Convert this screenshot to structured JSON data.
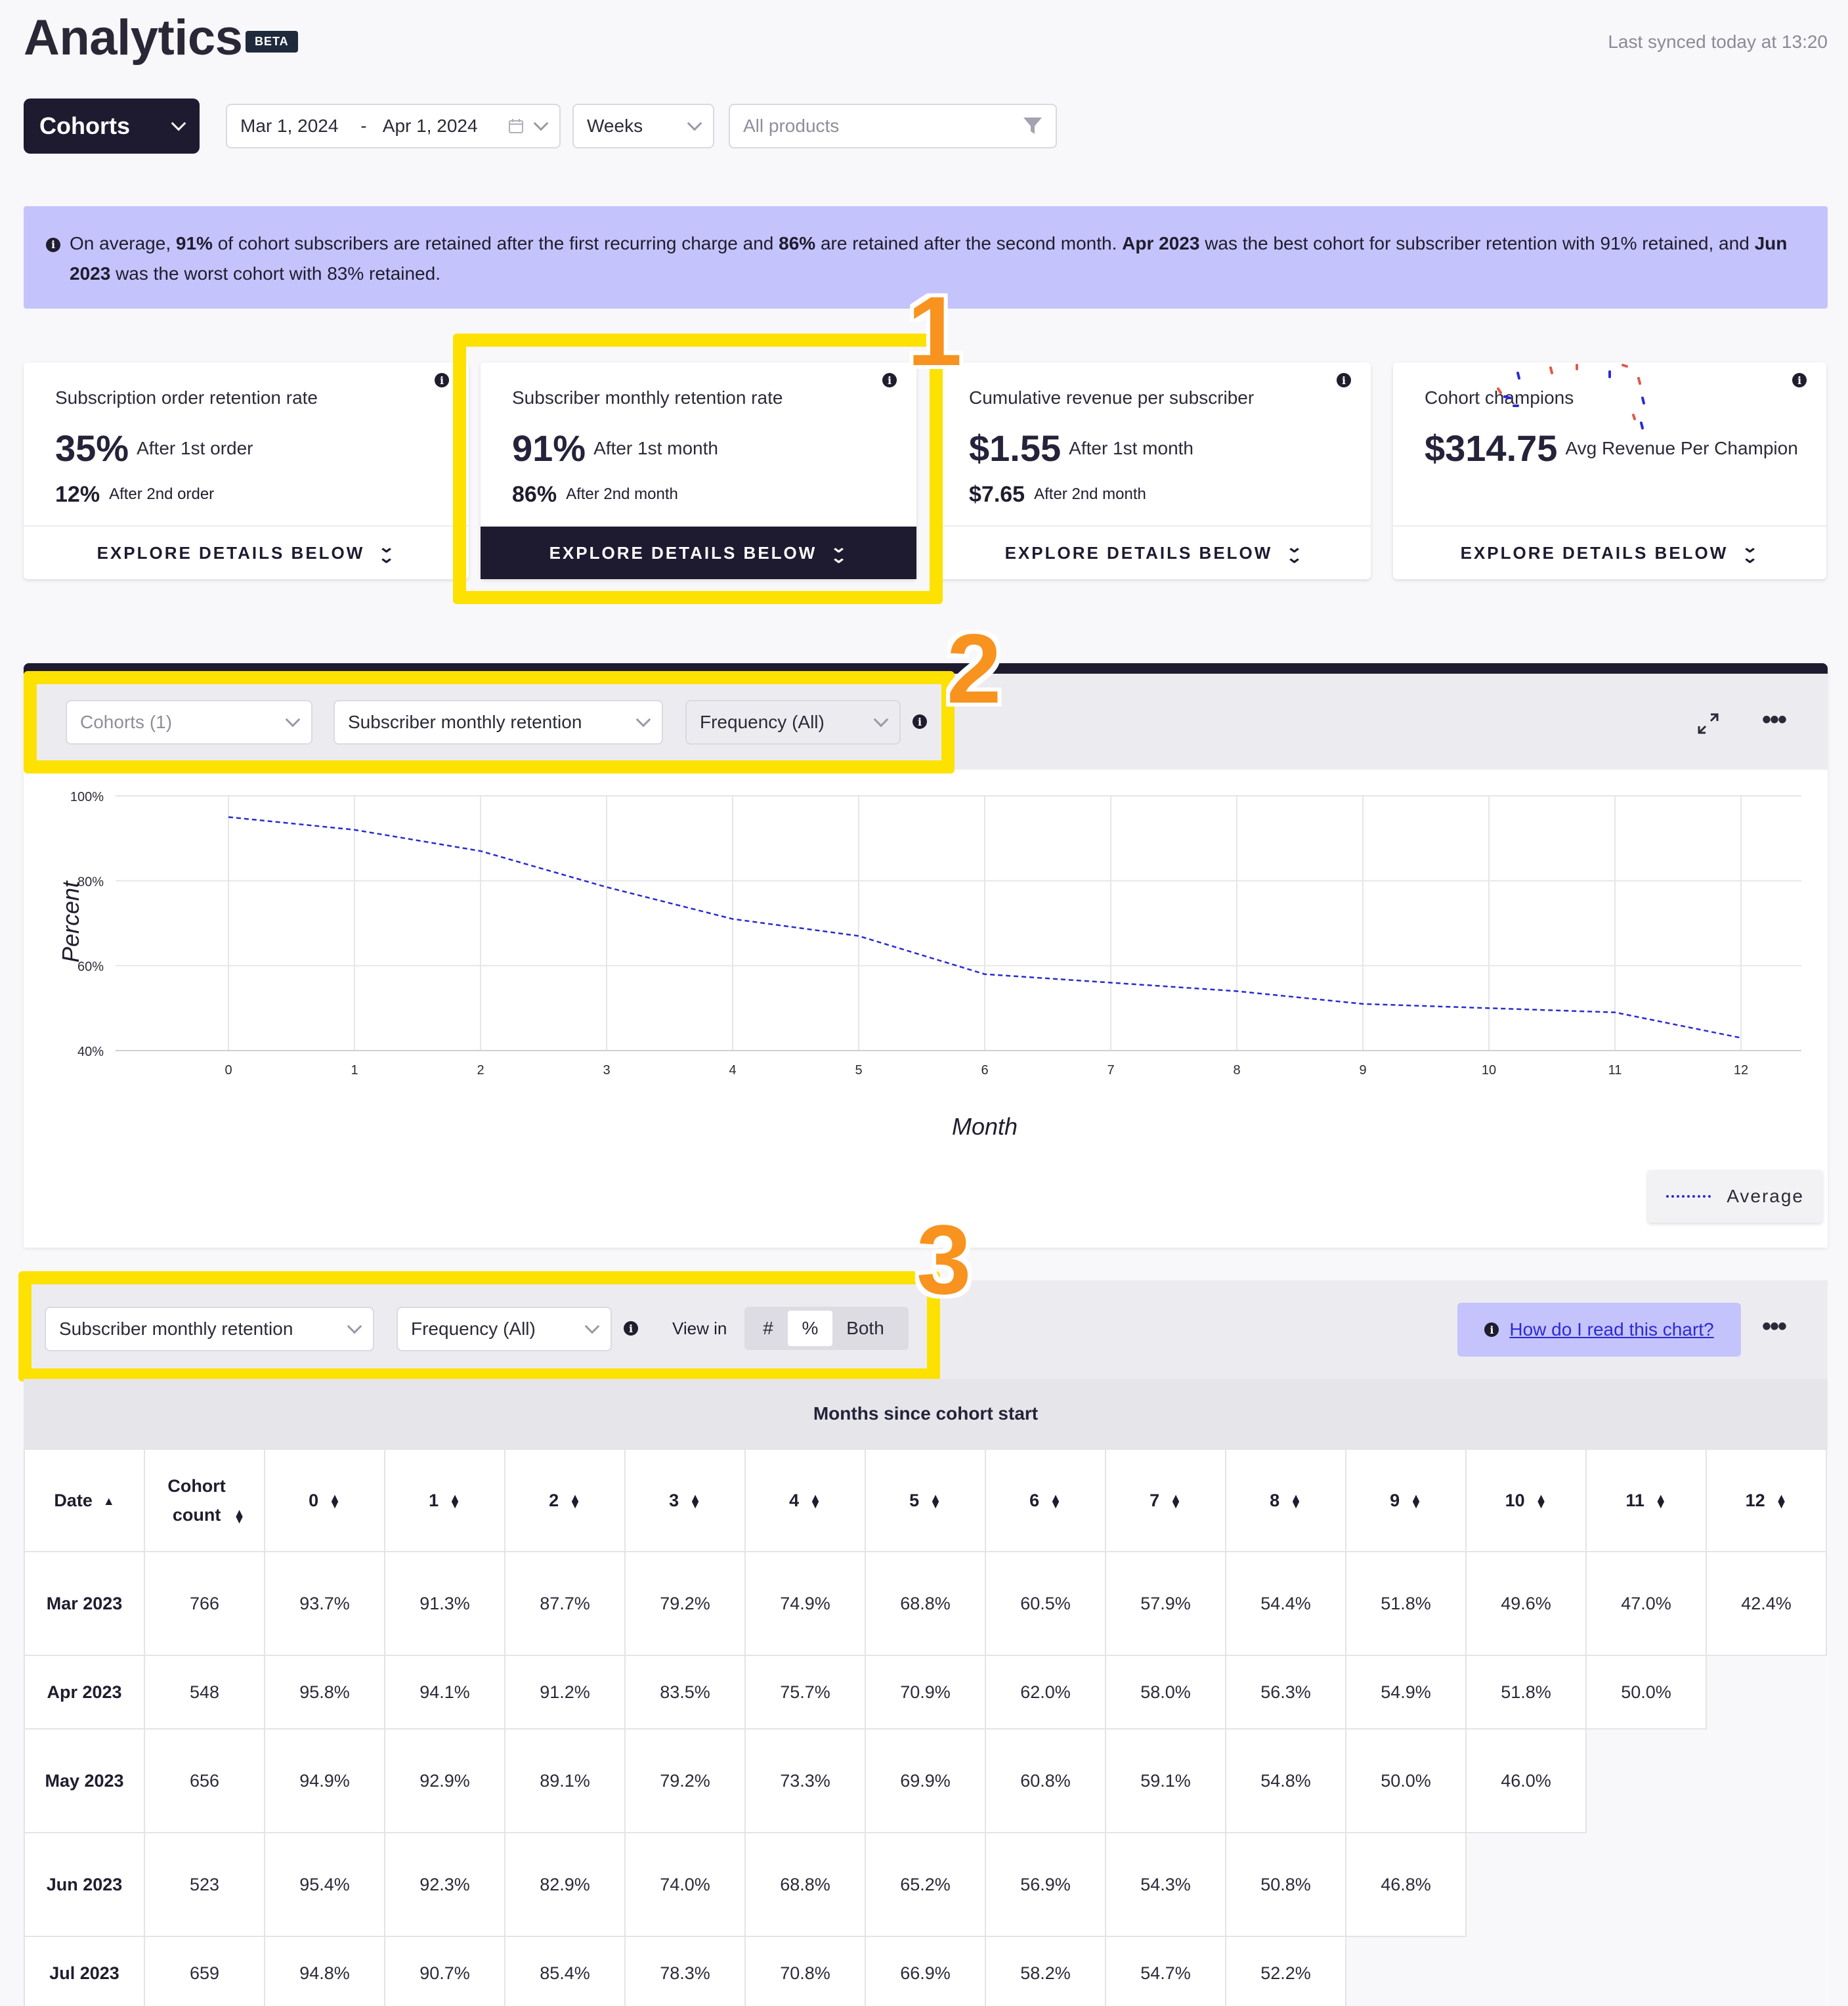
{
  "header": {
    "title": "Analytics",
    "beta": "BETA",
    "synced": "Last synced today at 13:20"
  },
  "toolbar": {
    "view": "Cohorts",
    "date_start": "Mar 1, 2024",
    "date_sep": "-",
    "date_end": "Apr 1, 2024",
    "interval": "Weeks",
    "products_placeholder": "All products"
  },
  "banner": {
    "t1": "On average, ",
    "b1": "91%",
    "t2": " of cohort subscribers are retained after the first recurring charge and ",
    "b2": "86%",
    "t3": " are retained after the second month. ",
    "b3": "Apr 2023",
    "t4": " was the best cohort for subscriber retention with 91% retained, and ",
    "b4": "Jun 2023",
    "t5": " was the worst cohort with 83% retained."
  },
  "cards": [
    {
      "title": "Subscription order retention rate",
      "big": "35%",
      "big_sub": "After 1st order",
      "small": "12%",
      "small_sub": "After 2nd order",
      "button": "EXPLORE DETAILS BELOW"
    },
    {
      "title": "Subscriber monthly retention rate",
      "big": "91%",
      "big_sub": "After 1st month",
      "small": "86%",
      "small_sub": "After 2nd month",
      "button": "EXPLORE DETAILS BELOW"
    },
    {
      "title": "Cumulative revenue per subscriber",
      "big": "$1.55",
      "big_sub": "After 1st month",
      "small": "$7.65",
      "small_sub": "After 2nd month",
      "button": "EXPLORE DETAILS BELOW"
    },
    {
      "title": "Cohort champions",
      "big": "$314.75",
      "big_sub": "Avg Revenue Per Champion",
      "small": "",
      "small_sub": "",
      "button": "EXPLORE DETAILS BELOW"
    }
  ],
  "annotations": {
    "one": "1",
    "two": "2",
    "three": "3"
  },
  "chart_toolbar": {
    "cohorts": "Cohorts (1)",
    "metric": "Subscriber monthly retention",
    "frequency": "Frequency (All)"
  },
  "chart_data": {
    "type": "line",
    "xlabel": "Month",
    "ylabel": "Percent",
    "ylim": [
      40,
      100
    ],
    "yticks": [
      "100%",
      "80%",
      "60%",
      "40%"
    ],
    "x": [
      0,
      1,
      2,
      3,
      4,
      5,
      6,
      7,
      8,
      9,
      10,
      11,
      12
    ],
    "series": [
      {
        "name": "Average",
        "values": [
          95.0,
          92.0,
          87.0,
          78.5,
          71.0,
          67.0,
          58.0,
          56.0,
          54.0,
          51.0,
          50.0,
          49.0,
          43.0
        ],
        "color": "#2a2ad0",
        "style": "dashed"
      }
    ],
    "grid": true,
    "legend": "bottom-right"
  },
  "table_toolbar": {
    "metric": "Subscriber monthly retention",
    "frequency": "Frequency (All)",
    "view_in": "View in",
    "opt_count": "#",
    "opt_pct": "%",
    "opt_both": "Both",
    "help": "How do I read this chart?"
  },
  "table": {
    "group_header": "Months since cohort start",
    "col_date": "Date",
    "col_count": "Cohort count",
    "month_cols": [
      "0",
      "1",
      "2",
      "3",
      "4",
      "5",
      "6",
      "7",
      "8",
      "9",
      "10",
      "11",
      "12"
    ],
    "rows": [
      {
        "date": "Mar 2023",
        "count": "766",
        "values": [
          "93.7%",
          "91.3%",
          "87.7%",
          "79.2%",
          "74.9%",
          "68.8%",
          "60.5%",
          "57.9%",
          "54.4%",
          "51.8%",
          "49.6%",
          "47.0%",
          "42.4%"
        ]
      },
      {
        "date": "Apr 2023",
        "count": "548",
        "values": [
          "95.8%",
          "94.1%",
          "91.2%",
          "83.5%",
          "75.7%",
          "70.9%",
          "62.0%",
          "58.0%",
          "56.3%",
          "54.9%",
          "51.8%",
          "50.0%"
        ]
      },
      {
        "date": "May 2023",
        "count": "656",
        "values": [
          "94.9%",
          "92.9%",
          "89.1%",
          "79.2%",
          "73.3%",
          "69.9%",
          "60.8%",
          "59.1%",
          "54.8%",
          "50.0%",
          "46.0%"
        ]
      },
      {
        "date": "Jun 2023",
        "count": "523",
        "values": [
          "95.4%",
          "92.3%",
          "82.9%",
          "74.0%",
          "68.8%",
          "65.2%",
          "56.9%",
          "54.3%",
          "50.8%",
          "46.8%"
        ]
      },
      {
        "date": "Jul 2023",
        "count": "659",
        "values": [
          "94.8%",
          "90.7%",
          "85.4%",
          "78.3%",
          "70.8%",
          "66.9%",
          "58.2%",
          "54.7%",
          "52.2%"
        ]
      }
    ]
  },
  "colors": {
    "dark": "#1e1b30",
    "highlight": "#fde100",
    "annotation": "#f7931e",
    "banner": "#c5c3fb",
    "line": "#2a2ad0"
  }
}
